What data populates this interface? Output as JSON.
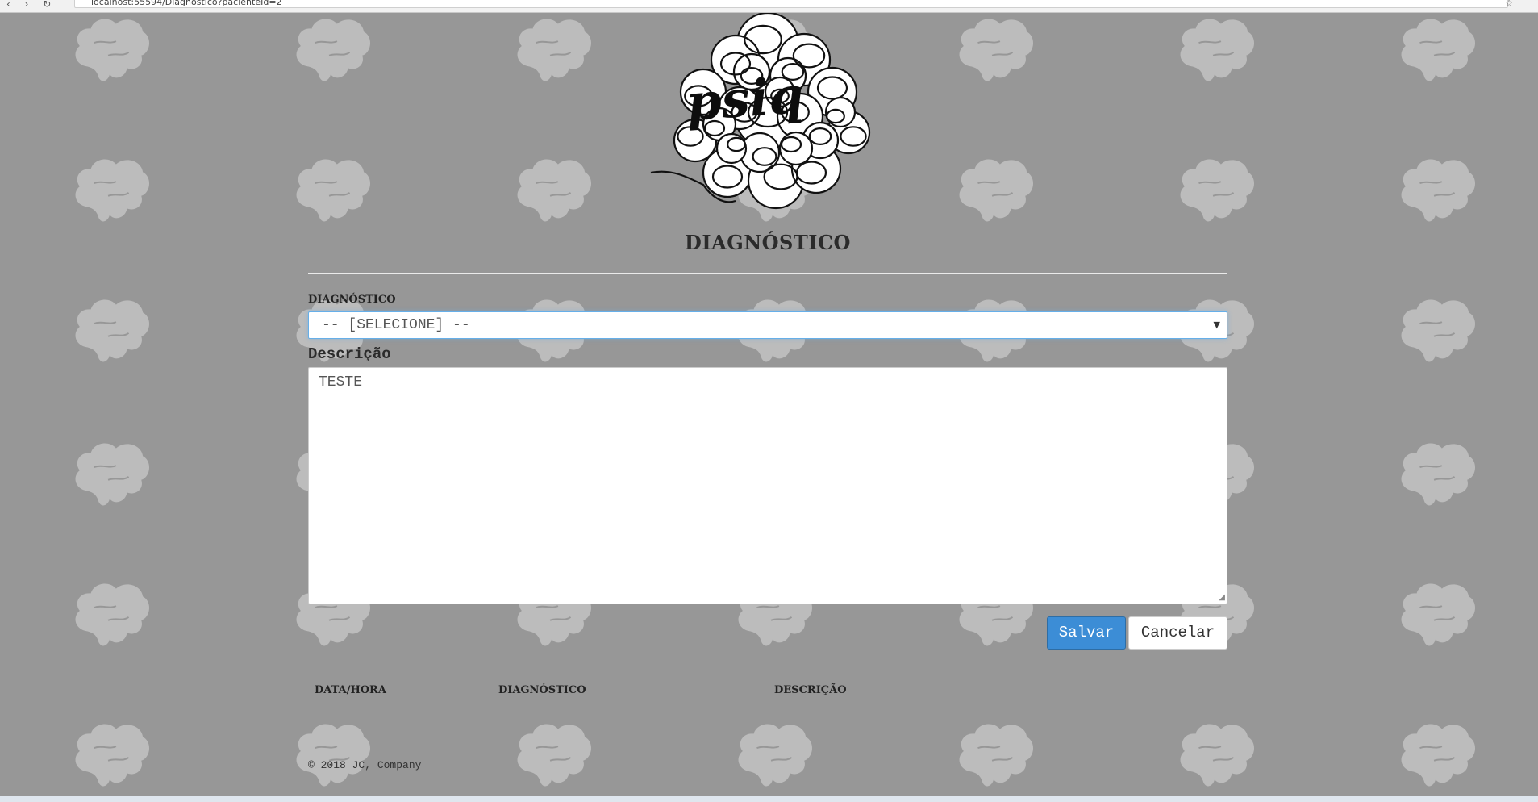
{
  "browser": {
    "url": "localhost:55594/Diagnostico?pacienteId=2"
  },
  "logo": {
    "text": "psiq"
  },
  "page": {
    "title": "DIAGNÓSTICO"
  },
  "form": {
    "diagnostico_label": "DIAGNÓSTICO",
    "diagnostico_selected": "-- [SELECIONE] --",
    "descricao_label": "Descrição",
    "descricao_value": "TESTE"
  },
  "actions": {
    "save_label": "Salvar",
    "cancel_label": "Cancelar"
  },
  "table": {
    "columns": [
      "DATA/HORA",
      "DIAGNÓSTICO",
      "DESCRIÇÃO"
    ],
    "rows": []
  },
  "footer": {
    "text": "© 2018 JC, Company"
  },
  "colors": {
    "background": "#979797",
    "brain_tile": "#bcbcbc",
    "primary": "#3c8dd6"
  }
}
